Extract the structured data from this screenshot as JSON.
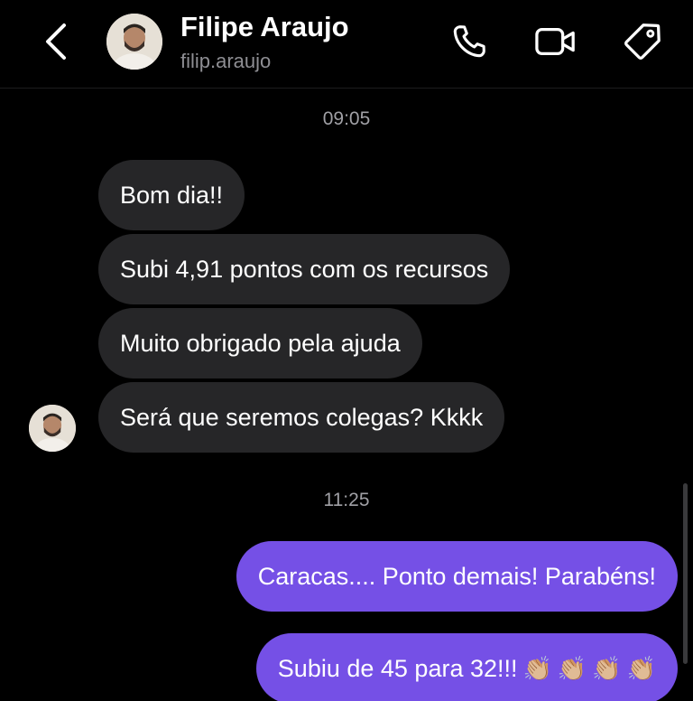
{
  "header": {
    "name": "Filipe Araujo",
    "username": "filip.araujo"
  },
  "timestamps": [
    "09:05",
    "11:25"
  ],
  "incoming_messages": [
    "Bom dia!!",
    "Subi 4,91 pontos com os recursos",
    "Muito obrigado pela ajuda",
    "Será que seremos colegas? Kkkk"
  ],
  "outgoing_messages": [
    "Caracas.... Ponto demais! Parabéns!",
    "Subiu de 45 para 32!!!"
  ],
  "emoji": {
    "clapping": "👏🏼"
  },
  "colors": {
    "background": "#000000",
    "incoming_bubble": "#262628",
    "outgoing_bubble": "#7550e6",
    "secondary_text": "#8e8e93"
  },
  "icons": [
    "chevron-left-icon",
    "phone-icon",
    "video-camera-icon",
    "tag-icon"
  ]
}
